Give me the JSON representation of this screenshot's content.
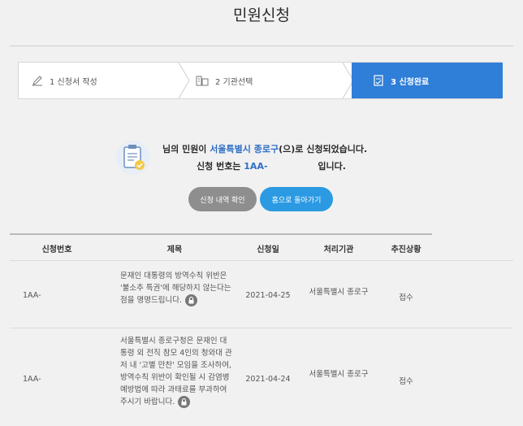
{
  "page": {
    "title": "민원신청"
  },
  "steps": [
    {
      "label": "1 신청서 작성",
      "icon": "pencil-icon"
    },
    {
      "label": "2 기관선택",
      "icon": "building-icon"
    },
    {
      "label": "3 신청완료",
      "icon": "document-icon",
      "active": true
    }
  ],
  "result": {
    "prefix": "님의 민원이",
    "agency": "서울특별시 종로구",
    "suffix": "(으)로 신청되었습니다.",
    "number_label": "신청 번호는",
    "number": "1AA-",
    "number_suffix": "입니다."
  },
  "buttons": {
    "check": "신청 내역 확인",
    "home": "홈으로 돌아가기"
  },
  "table": {
    "headers": [
      "신청번호",
      "제목",
      "신청일",
      "처리기관",
      "추진상황"
    ],
    "rows": [
      {
        "no": "1AA-",
        "subject": "문재인 대통령의 방역수칙 위반은 '불소추 특권'에 해당하지 않는다는 점을 명명드립니다.",
        "date": "2021-04-25",
        "agency": "서울특별시 종로구",
        "status": "접수"
      },
      {
        "no": "1AA-",
        "subject": "서울특별시 종로구청은 문재인 대통령 외 전직 참모 4인의 청와대 관저 내 '고별 만찬' 모임을 조사하여, 방역수칙 위반이 확인될 시 감염병예방법에 따라 과태료를 부과하여 주시기 바랍니다.",
        "date": "2021-04-24",
        "agency": "서울특별시 종로구",
        "status": "접수"
      }
    ]
  },
  "colors": {
    "accent": "#2f7ed8",
    "home_button": "#2b9ae2",
    "check_button": "#8e8e8e"
  }
}
